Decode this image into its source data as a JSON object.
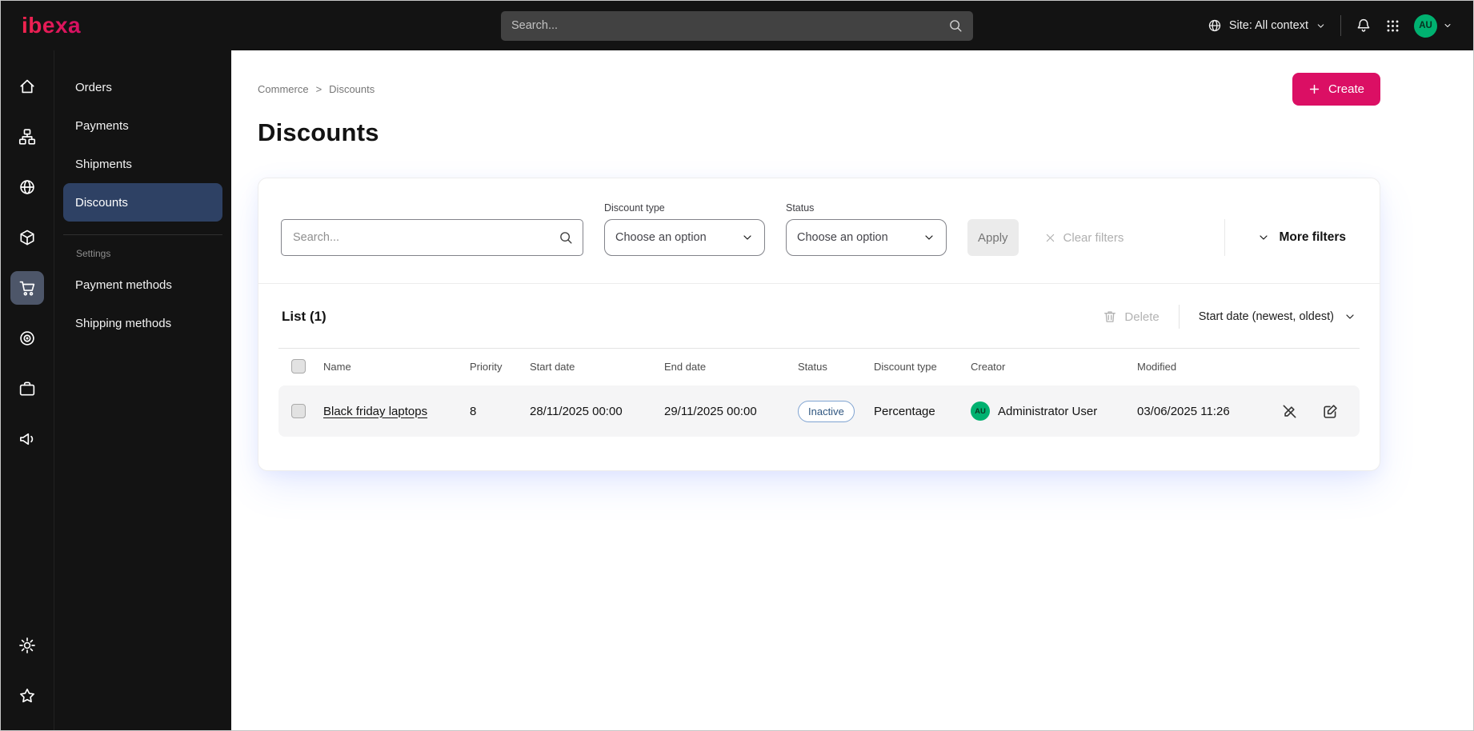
{
  "colors": {
    "accent": "#db0f64",
    "topbar_bg": "#131313",
    "menu_active_bg": "#2e4164",
    "icon_active_bg": "#4d5669",
    "badge_inactive_border": "#7fa3d1",
    "badge_inactive_text": "#2f5680",
    "avatar_green": "#00b170"
  },
  "topbar": {
    "logo_text": "ibexa",
    "search_placeholder": "Search...",
    "site_context_label": "Site: All context",
    "avatar_initials": "AU",
    "icons": [
      "search-icon",
      "globe-icon",
      "chevron-down-icon",
      "bell-icon",
      "apps-grid-icon"
    ]
  },
  "sidebar": {
    "icons": [
      "home-icon",
      "content-tree-icon",
      "globe-icon",
      "product-catalog-icon",
      "commerce-cart-icon",
      "target-icon",
      "briefcase-icon",
      "megaphone-icon"
    ],
    "active_icon": "commerce-cart-icon",
    "bottom_icons": [
      "gear-icon",
      "star-icon"
    ]
  },
  "menu": {
    "items": [
      {
        "label": "Orders"
      },
      {
        "label": "Payments"
      },
      {
        "label": "Shipments"
      },
      {
        "label": "Discounts"
      }
    ],
    "active_item": "Discounts",
    "settings_header": "Settings",
    "settings_items": [
      {
        "label": "Payment methods"
      },
      {
        "label": "Shipping methods"
      }
    ]
  },
  "breadcrumb": {
    "items": [
      "Commerce",
      "Discounts"
    ],
    "separator": ">"
  },
  "page": {
    "title": "Discounts",
    "create_button_label": "Create"
  },
  "filters": {
    "search_placeholder": "Search...",
    "discount_type": {
      "label": "Discount type",
      "value": "Choose an option"
    },
    "status": {
      "label": "Status",
      "value": "Choose an option"
    },
    "apply_label": "Apply",
    "clear_filters_label": "Clear filters",
    "more_filters_label": "More filters"
  },
  "list": {
    "title": "List (1)",
    "delete_label": "Delete",
    "sort_label": "Start date (newest, oldest)",
    "columns": [
      "Name",
      "Priority",
      "Start date",
      "End date",
      "Status",
      "Discount type",
      "Creator",
      "Modified"
    ],
    "rows": [
      {
        "name": "Black friday laptops",
        "priority": "8",
        "start_date": "28/11/2025 00:00",
        "end_date": "29/11/2025 00:00",
        "status": "Inactive",
        "discount_type": "Percentage",
        "creator_initials": "AU",
        "creator": "Administrator User",
        "modified": "03/06/2025 11:26"
      }
    ]
  }
}
